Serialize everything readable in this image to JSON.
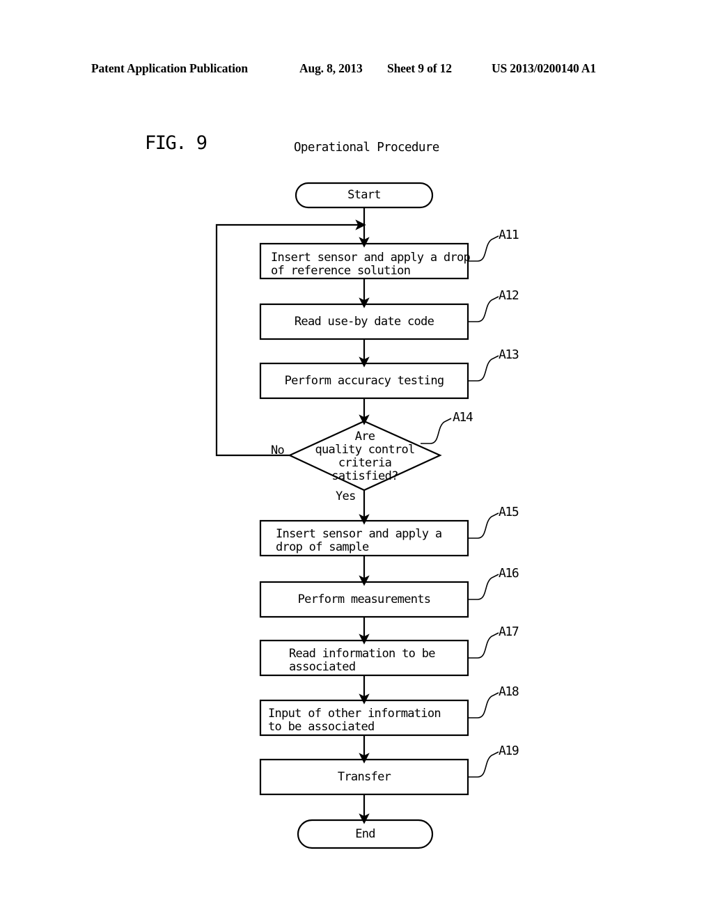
{
  "header": {
    "publication": "Patent Application Publication",
    "date": "Aug. 8, 2013",
    "sheet": "Sheet 9 of 12",
    "patent_number": "US 2013/0200140 A1"
  },
  "figure": {
    "label": "FIG. 9",
    "title": "Operational Procedure"
  },
  "flow": {
    "start": {
      "text": "Start"
    },
    "end": {
      "text": "End"
    },
    "branch_no": "No",
    "branch_yes": "Yes",
    "steps": [
      {
        "ref": "A11",
        "line1": "Insert sensor and apply a drop",
        "line2": "of reference solution",
        "align": "left"
      },
      {
        "ref": "A12",
        "line1": "Read use-by date code",
        "line2": "",
        "align": "center"
      },
      {
        "ref": "A13",
        "line1": "Perform accuracy testing",
        "line2": "",
        "align": "center"
      },
      {
        "ref": "A14",
        "line1": "Are",
        "line2": "quality control",
        "line3": "criteria",
        "line4": "satisfied?",
        "align": "center",
        "shape": "decision"
      },
      {
        "ref": "A15",
        "line1": "Insert sensor and apply a",
        "line2": "drop of sample",
        "align": "left"
      },
      {
        "ref": "A16",
        "line1": "Perform measurements",
        "line2": "",
        "align": "center"
      },
      {
        "ref": "A17",
        "line1": "Read information to be",
        "line2": "associated",
        "align": "left"
      },
      {
        "ref": "A18",
        "line1": "Input of other information",
        "line2": "to be associated",
        "align": "left"
      },
      {
        "ref": "A19",
        "line1": "Transfer",
        "line2": "",
        "align": "center"
      }
    ]
  },
  "colors": {
    "ink": "#000000",
    "paper": "#ffffff"
  }
}
